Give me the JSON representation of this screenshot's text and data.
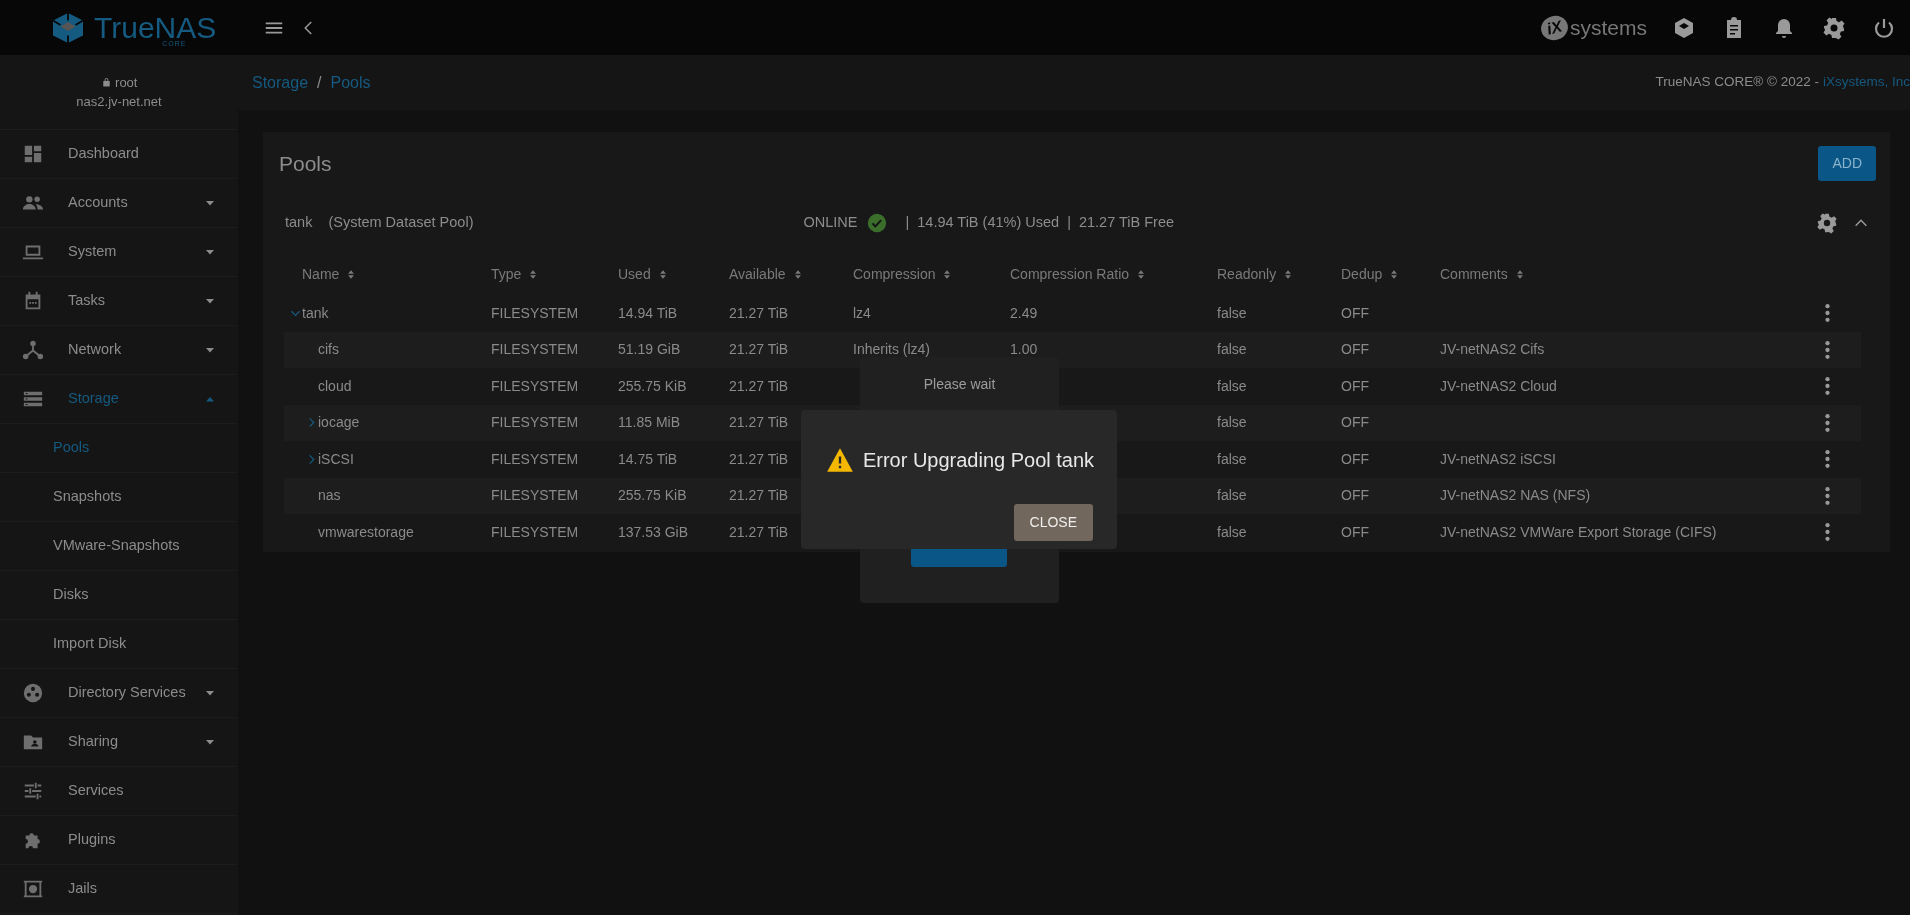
{
  "topbar": {
    "logo": {
      "text": "TrueNAS",
      "edition": "CORE"
    },
    "vendor_logo": {
      "mark": "iX",
      "text": "systems"
    }
  },
  "user": {
    "name": "root",
    "host": "nas2.jv-net.net"
  },
  "sidebar": {
    "items": [
      {
        "label": "Dashboard",
        "selected": false
      },
      {
        "label": "Accounts",
        "selected": false,
        "expanded": false
      },
      {
        "label": "System",
        "selected": false,
        "expanded": false
      },
      {
        "label": "Tasks",
        "selected": false,
        "expanded": false
      },
      {
        "label": "Network",
        "selected": false,
        "expanded": false
      },
      {
        "label": "Storage",
        "selected": true,
        "expanded": true,
        "children": [
          {
            "label": "Pools",
            "selected": true
          },
          {
            "label": "Snapshots",
            "selected": false
          },
          {
            "label": "VMware-Snapshots",
            "selected": false
          },
          {
            "label": "Disks",
            "selected": false
          },
          {
            "label": "Import Disk",
            "selected": false
          }
        ]
      },
      {
        "label": "Directory Services",
        "selected": false,
        "expanded": false
      },
      {
        "label": "Sharing",
        "selected": false,
        "expanded": false
      },
      {
        "label": "Services",
        "selected": false
      },
      {
        "label": "Plugins",
        "selected": false
      },
      {
        "label": "Jails",
        "selected": false
      }
    ]
  },
  "breadcrumb": {
    "items": [
      "Storage",
      "Pools"
    ],
    "separator": "/"
  },
  "copyright": {
    "text": "TrueNAS CORE® © 2022 -",
    "link": "iXsystems, Inc"
  },
  "pools_card": {
    "title": "Pools",
    "add_button": "ADD",
    "pool": {
      "name": "tank",
      "note": "(System Dataset Pool)",
      "status": "ONLINE",
      "separator": "|",
      "stats": [
        "14.94 TiB (41%) Used",
        "21.27 TiB Free"
      ],
      "expanded": true
    },
    "table": {
      "columns": [
        "Name",
        "Type",
        "Used",
        "Available",
        "Compression",
        "Compression Ratio",
        "Readonly",
        "Dedup",
        "Comments"
      ],
      "rows": [
        {
          "name": "tank",
          "type": "FILESYSTEM",
          "used": "14.94 TiB",
          "available": "21.27 TiB",
          "compression": "lz4",
          "compression_ratio": "2.49",
          "readonly": "false",
          "dedup": "OFF",
          "expanded": true,
          "children": [
            {
              "name": "cifs",
              "type": "FILESYSTEM",
              "used": "51.19 GiB",
              "available": "21.27 TiB",
              "compression": "Inherits (lz4)",
              "compression_ratio": "1.00",
              "readonly": "false",
              "dedup": "OFF",
              "comments": "JV-netNAS2 Cifs"
            },
            {
              "name": "cloud",
              "type": "FILESYSTEM",
              "used": "255.75 KiB",
              "available": "21.27 TiB",
              "readonly": "false",
              "dedup": "OFF",
              "comments": "JV-netNAS2 Cloud"
            },
            {
              "name": "iocage",
              "type": "FILESYSTEM",
              "used": "11.85 MiB",
              "available": "21.27 TiB",
              "readonly": "false",
              "dedup": "OFF",
              "expanded": false
            },
            {
              "name": "iSCSI",
              "type": "FILESYSTEM",
              "used": "14.75 TiB",
              "available": "21.27 TiB",
              "readonly": "false",
              "dedup": "OFF",
              "comments": "JV-netNAS2 iSCSI",
              "expanded": false
            },
            {
              "name": "nas",
              "type": "FILESYSTEM",
              "used": "255.75 KiB",
              "available": "21.27 TiB",
              "readonly": "false",
              "dedup": "OFF",
              "comments": "JV-netNAS2 NAS (NFS)"
            },
            {
              "name": "vmwarestorage",
              "type": "FILESYSTEM",
              "used": "137.53 GiB",
              "available": "21.27 TiB",
              "readonly": "false",
              "dedup": "OFF",
              "comments": "JV-netNAS2 VMWare Export Storage (CIFS)"
            }
          ]
        }
      ]
    }
  },
  "wait_dialog": {
    "title": "Please wait"
  },
  "error_dialog": {
    "title": "Error Upgrading Pool tank",
    "button": "CLOSE"
  }
}
